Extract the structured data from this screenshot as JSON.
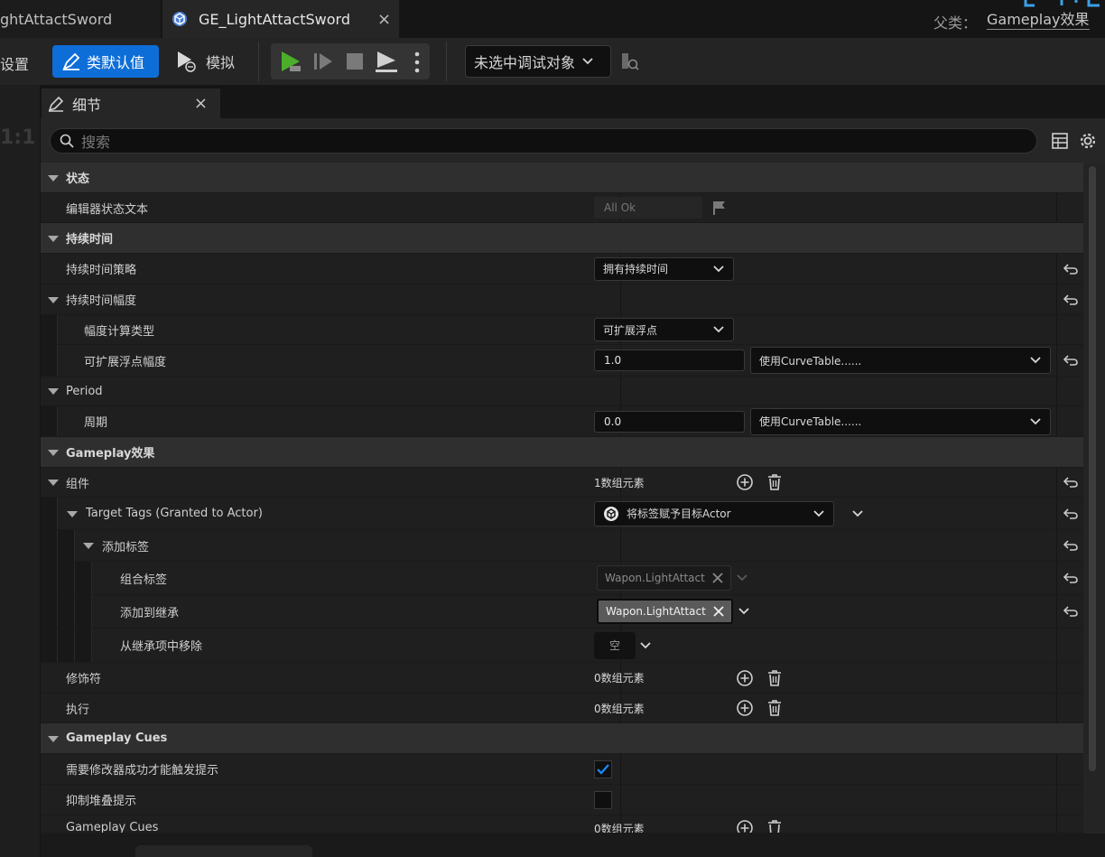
{
  "tabs": {
    "prev_label": "ghtAttactSword",
    "active_label": "GE_LightAttactSword",
    "close_glyph": "×"
  },
  "parent": {
    "label": "父类：",
    "value": "Gameplay效果"
  },
  "toolbar": {
    "settings_label": "类设置",
    "settings_visible": "设置",
    "defaults_label": "类默认值",
    "simulate_label": "模拟",
    "debug_select": "未选中调试对象"
  },
  "details": {
    "tab_label": "细节",
    "close_glyph": "×",
    "search_placeholder": "搜索"
  },
  "viewport": {
    "zoom": "1:1"
  },
  "sections": {
    "status": "状态",
    "duration": "持续时间",
    "period": "Period",
    "gameplay_effect": "Gameplay效果",
    "gameplay_cues": "Gameplay Cues"
  },
  "rows": {
    "editor_status_text": {
      "label": "编辑器状态文本",
      "value": "All Ok"
    },
    "duration_policy": {
      "label": "持续时间策略",
      "value": "拥有持续时间"
    },
    "duration_magnitude": {
      "label": "持续时间幅度"
    },
    "magnitude_calc_type": {
      "label": "幅度计算类型",
      "value": "可扩展浮点"
    },
    "scalable_float_magnitude": {
      "label": "可扩展浮点幅度",
      "value": "1.0",
      "curve": "使用CurveTable......"
    },
    "period": {
      "label": "周期",
      "value": "0.0",
      "curve": "使用CurveTable......"
    },
    "components": {
      "label": "组件",
      "value": "1数组元素"
    },
    "target_tags": {
      "label": "Target Tags (Granted to Actor)",
      "value": "将标签赋予目标Actor"
    },
    "add_tags": {
      "label": "添加标签"
    },
    "combined_tags": {
      "label": "组合标签",
      "tag": "Wapon.LightAttact"
    },
    "added": {
      "label": "添加到继承",
      "tag": "Wapon.LightAttact"
    },
    "removed": {
      "label": "从继承项中移除",
      "value": "空"
    },
    "modifiers": {
      "label": "修饰符",
      "value": "0数组元素"
    },
    "executions": {
      "label": "执行",
      "value": "0数组元素"
    },
    "require_modifier_success": {
      "label": "需要修改器成功才能触发提示",
      "checked": true
    },
    "suppress_stacking": {
      "label": "抑制堆叠提示",
      "checked": false
    },
    "gameplay_cues_list": {
      "label": "Gameplay Cues",
      "value": "0数组元素"
    }
  },
  "colors": {
    "accent": "#0e6ed8",
    "play_green": "#4caf2a"
  }
}
